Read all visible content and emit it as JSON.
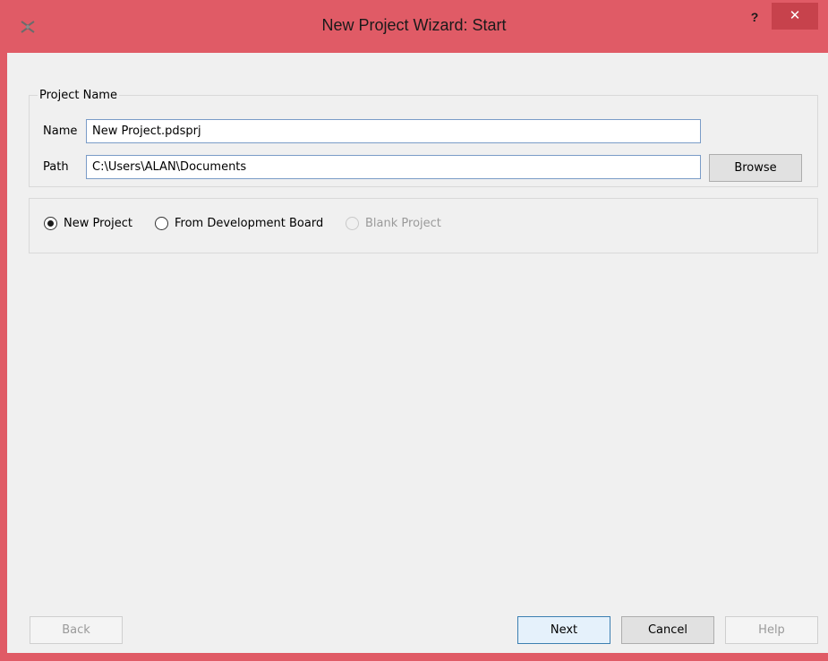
{
  "window": {
    "title": "New Project Wizard: Start"
  },
  "titlebar": {
    "help_label": "?",
    "close_label": "✕"
  },
  "project_name_group": {
    "legend": "Project Name",
    "name_label": "Name",
    "name_value": "New Project.pdsprj",
    "path_label": "Path",
    "path_value": "C:\\Users\\ALAN\\Documents",
    "browse_label": "Browse"
  },
  "project_type": {
    "options": [
      {
        "label": "New Project",
        "selected": true,
        "enabled": true
      },
      {
        "label": "From Development Board",
        "selected": false,
        "enabled": true
      },
      {
        "label": "Blank Project",
        "selected": false,
        "enabled": false
      }
    ]
  },
  "footer": {
    "back_label": "Back",
    "next_label": "Next",
    "cancel_label": "Cancel",
    "help_label": "Help"
  },
  "colors": {
    "frame": "#e05b66",
    "close_button": "#c7424c",
    "client_bg": "#f0f0f0"
  }
}
